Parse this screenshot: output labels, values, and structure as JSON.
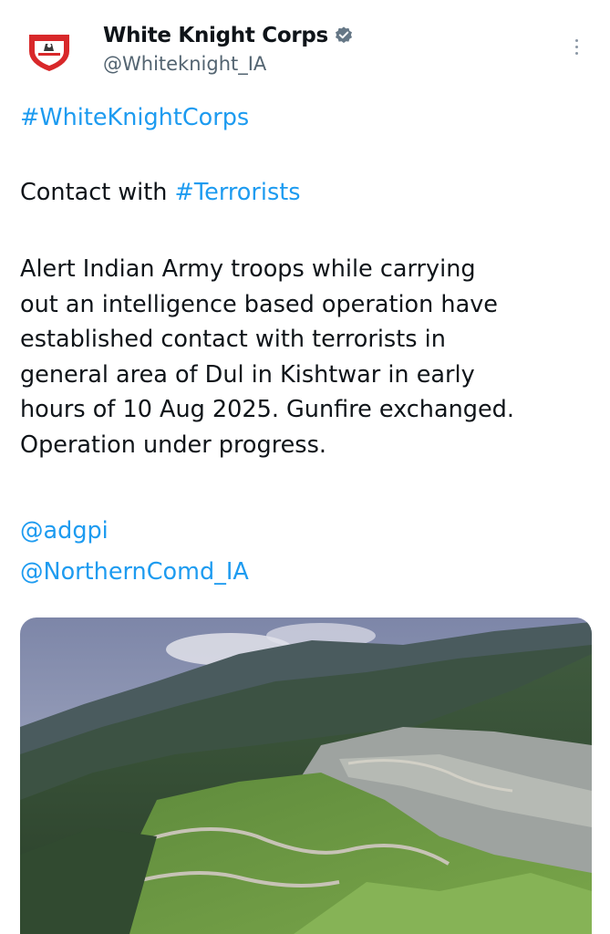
{
  "tweet": {
    "author": {
      "display_name": "White Knight Corps",
      "handle": "@Whiteknight_IA",
      "avatar_icon": "white-knight-corps-emblem",
      "verified_icon": "verified-badge-icon",
      "verified_color": "#657786"
    },
    "hashtag_line": "#WhiteKnightCorps",
    "contact_prefix": "Contact with ",
    "contact_tag": "#Terrorists",
    "body_lines": [
      "Alert Indian Army troops while carrying",
      "out an intelligence based operation have",
      "established contact with terrorists in",
      "general area of Dul in Kishtwar in early",
      "hours of 10 Aug 2025. Gunfire exchanged.",
      "Operation under progress."
    ],
    "mentions": [
      "@adgpi",
      "@NorthernComd_IA"
    ],
    "link_color": "#1d9bf0",
    "media_icon": "mountain-landscape-photo"
  }
}
